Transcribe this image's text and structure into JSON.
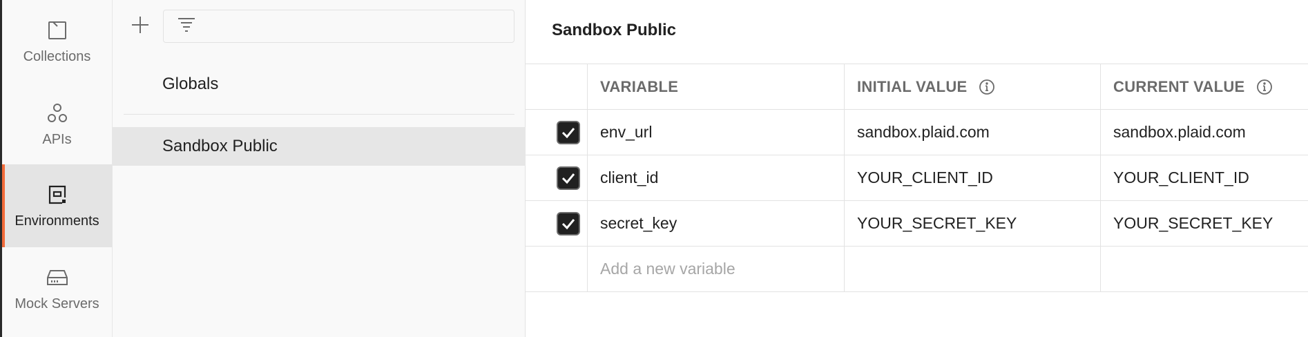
{
  "rail": {
    "items": [
      {
        "label": "Collections",
        "icon": "collections-icon",
        "active": false
      },
      {
        "label": "APIs",
        "icon": "apis-icon",
        "active": false
      },
      {
        "label": "Environments",
        "icon": "environments-icon",
        "active": true
      },
      {
        "label": "Mock Servers",
        "icon": "mock-servers-icon",
        "active": false
      }
    ]
  },
  "list": {
    "add_icon": "plus-icon",
    "filter_icon": "filter-icon",
    "filter_value": "",
    "items": [
      {
        "label": "Globals",
        "selected": false
      },
      {
        "label": "Sandbox Public",
        "selected": true
      }
    ]
  },
  "editor": {
    "title": "Sandbox Public",
    "columns": {
      "variable": "VARIABLE",
      "initial": "INITIAL VALUE",
      "current": "CURRENT VALUE"
    },
    "rows": [
      {
        "checked": true,
        "variable": "env_url",
        "initial": "sandbox.plaid.com",
        "current": "sandbox.plaid.com"
      },
      {
        "checked": true,
        "variable": "client_id",
        "initial": "YOUR_CLIENT_ID",
        "current": "YOUR_CLIENT_ID"
      },
      {
        "checked": true,
        "variable": "secret_key",
        "initial": "YOUR_SECRET_KEY",
        "current": "YOUR_SECRET_KEY"
      }
    ],
    "new_row_placeholder": "Add a new variable"
  },
  "colors": {
    "accent": "#f26b3a",
    "checkbox": "#212121",
    "header_text": "#6b6b6b",
    "placeholder": "#a6a6a6"
  }
}
